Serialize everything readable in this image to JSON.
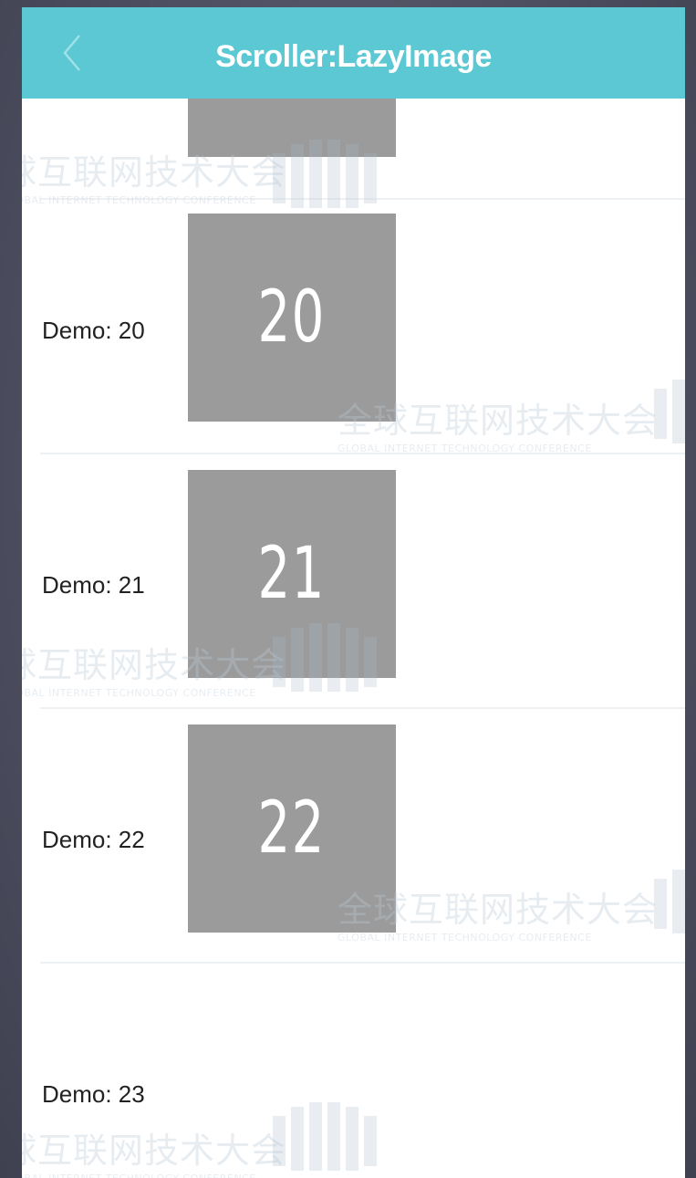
{
  "navbar": {
    "title": "Scroller:LazyImage",
    "back_icon": "chevron-left-icon"
  },
  "colors": {
    "navbar": "#5bc8d3",
    "placeholder_image": "#9b9b9b",
    "background": "#ffffff"
  },
  "rows": [
    {
      "label": "",
      "image_text": ""
    },
    {
      "label": "Demo: 20",
      "image_text": "20"
    },
    {
      "label": "Demo: 21",
      "image_text": "21"
    },
    {
      "label": "Demo: 22",
      "image_text": "22"
    },
    {
      "label": "Demo: 23",
      "image_text": ""
    }
  ],
  "watermark": {
    "text_cn": "全球互联网技术大会",
    "text_cn_partial": "球互联网技术大会",
    "text_en": "GLOBAL INTERNET TECHNOLOGY CONFERENCE"
  }
}
